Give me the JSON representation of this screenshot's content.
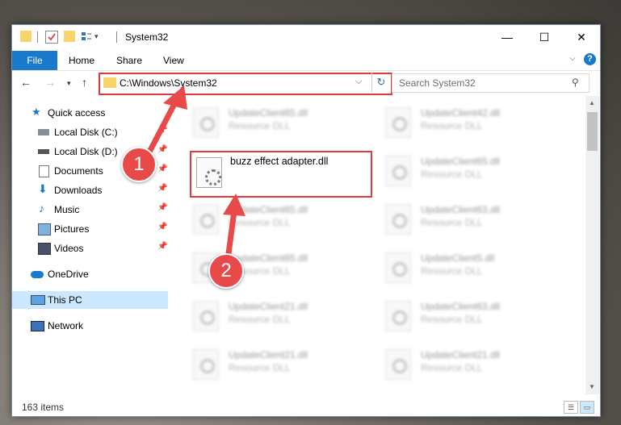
{
  "window": {
    "title": "System32",
    "controls": {
      "minimize": "—",
      "maximize": "☐",
      "close": "✕"
    }
  },
  "ribbon": {
    "tabs": [
      "File",
      "Home",
      "Share",
      "View"
    ],
    "help": "?"
  },
  "address": {
    "path": "C:\\Windows\\System32",
    "search_placeholder": "Search System32"
  },
  "nav_pane": {
    "items": [
      {
        "label": "Quick access",
        "icon": "star-icon",
        "pinned": false
      },
      {
        "label": "Local Disk (C:)",
        "icon": "drive-icon",
        "pinned": true
      },
      {
        "label": "Local Disk (D:)",
        "icon": "drive-icon",
        "pinned": true
      },
      {
        "label": "Documents",
        "icon": "documents-icon",
        "pinned": true
      },
      {
        "label": "Downloads",
        "icon": "download-icon",
        "pinned": true
      },
      {
        "label": "Music",
        "icon": "music-icon",
        "pinned": true
      },
      {
        "label": "Pictures",
        "icon": "pictures-icon",
        "pinned": true
      },
      {
        "label": "Videos",
        "icon": "videos-icon",
        "pinned": true
      },
      {
        "label": "OneDrive",
        "icon": "cloud-icon",
        "pinned": false
      },
      {
        "label": "This PC",
        "icon": "pc-icon",
        "pinned": false,
        "selected": true
      },
      {
        "label": "Network",
        "icon": "network-icon",
        "pinned": false
      }
    ]
  },
  "files": [
    {
      "name": "UpdateClient65.dll",
      "type": "Resource DLL"
    },
    {
      "name": "UpdateClient42.dll",
      "type": "Resource DLL"
    },
    {
      "name": "buzz effect adapter.dll",
      "type": "",
      "highlighted": true
    },
    {
      "name": "UpdateClient65.dll",
      "type": "Resource DLL"
    },
    {
      "name": "UpdateClient65.dll",
      "type": "Resource DLL"
    },
    {
      "name": "UpdateClient63.dll",
      "type": "Resource DLL"
    },
    {
      "name": "UpdateClient65.dll",
      "type": "Resource DLL"
    },
    {
      "name": "UpdateClient5.dll",
      "type": "Resource DLL"
    },
    {
      "name": "UpdateClient21.dll",
      "type": "Resource DLL"
    },
    {
      "name": "UpdateClient63.dll",
      "type": "Resource DLL"
    },
    {
      "name": "UpdateClient21.dll",
      "type": "Resource DLL"
    },
    {
      "name": "UpdateClient21.dll",
      "type": "Resource DLL"
    }
  ],
  "status": {
    "item_count": "163 items"
  },
  "annotations": {
    "step1": "1",
    "step2": "2",
    "accent": "#e03a3e"
  }
}
